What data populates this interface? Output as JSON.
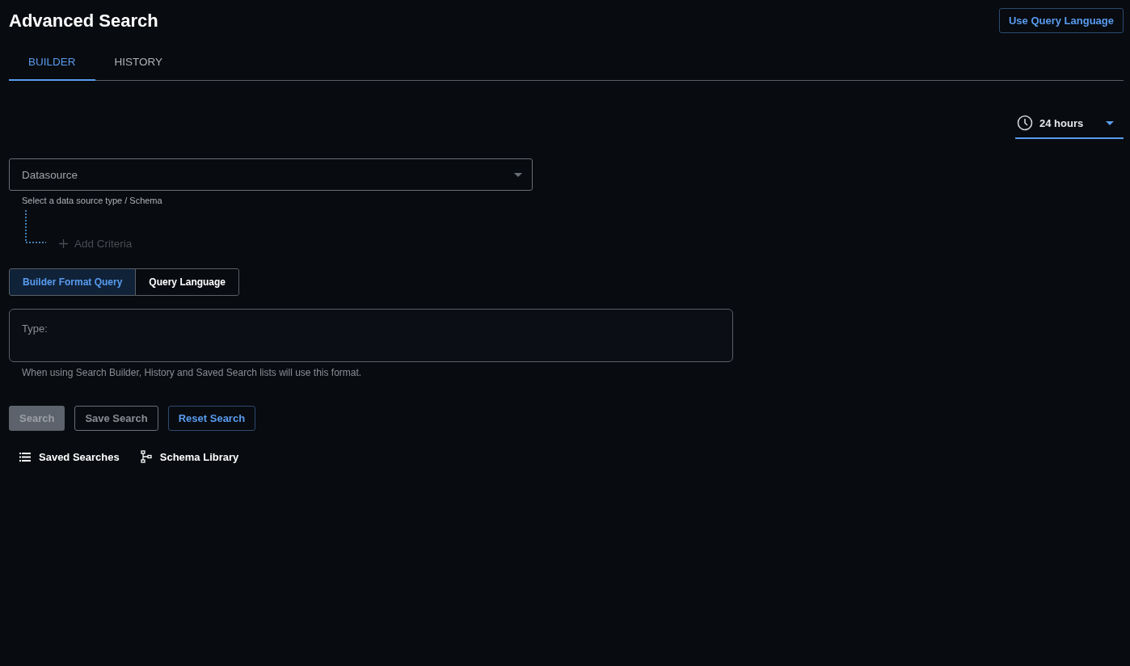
{
  "header": {
    "title": "Advanced Search",
    "action": "Use Query Language"
  },
  "tabs": [
    {
      "label": "BUILDER",
      "selected": true
    },
    {
      "label": "HISTORY",
      "selected": false
    }
  ],
  "time_range": {
    "value": "24 hours"
  },
  "datasource": {
    "placeholder": "Datasource",
    "helper": "Select a data source type / Schema"
  },
  "add_criteria": {
    "label": "Add Criteria",
    "disabled": true
  },
  "format_toggle": [
    {
      "label": "Builder Format Query",
      "selected": true
    },
    {
      "label": "Query Language",
      "selected": false
    }
  ],
  "query": {
    "placeholder": "Type:",
    "helper": "When using Search Builder, History and Saved Search lists will use this format."
  },
  "buttons": [
    {
      "label": "Search",
      "kind": "primary",
      "disabled": true
    },
    {
      "label": "Save Search",
      "kind": "outline",
      "disabled": true
    },
    {
      "label": "Reset Search",
      "kind": "accent",
      "disabled": false
    }
  ],
  "links": [
    {
      "label": "Saved Searches",
      "kind": "list"
    },
    {
      "label": "Schema Library",
      "kind": "schema"
    }
  ]
}
